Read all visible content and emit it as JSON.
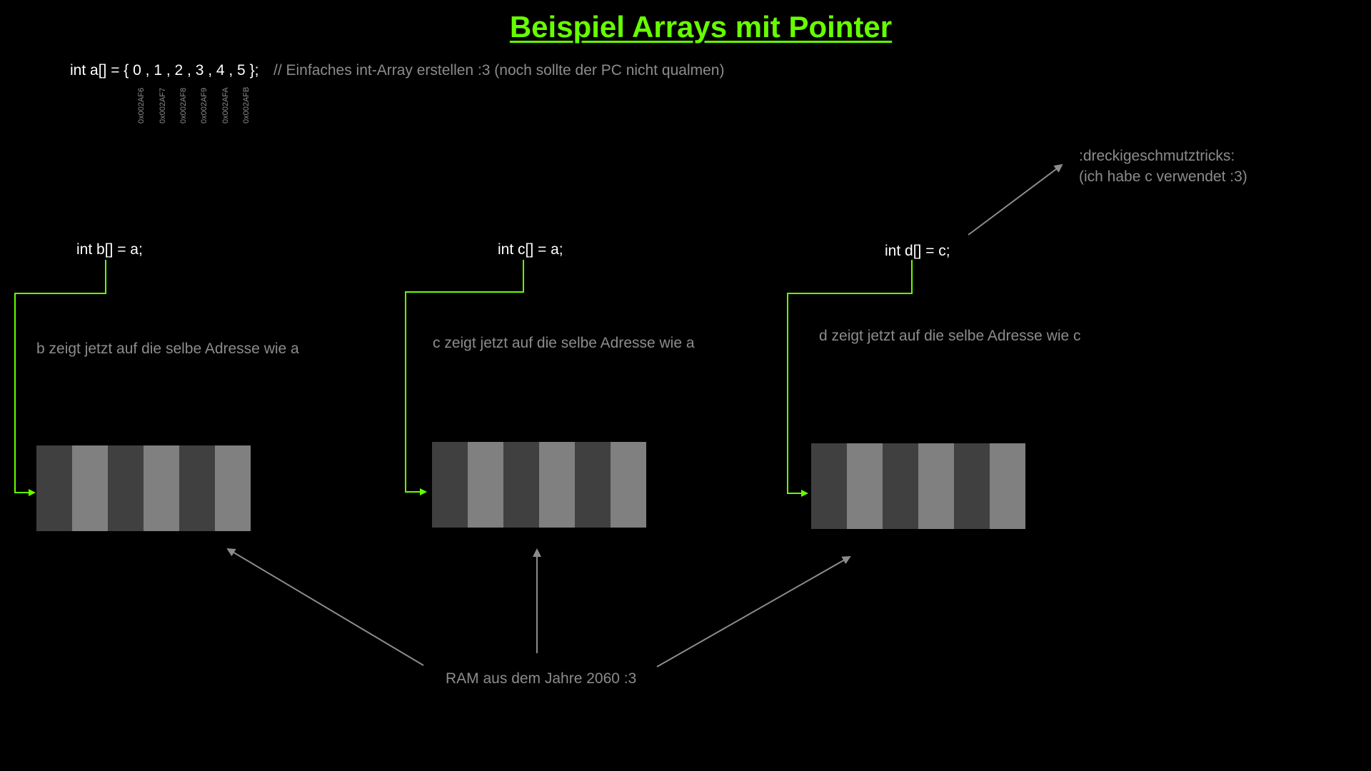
{
  "title": "Beispiel Arrays mit Pointer",
  "decl_a": {
    "code": "int a[] = { 0 , 1 , 2 , 3 , 4 , 5 };",
    "comment": "// Einfaches int-Array erstellen :3 (noch sollte der PC nicht qualmen)",
    "addresses": [
      "0x002AF6",
      "0x002AF7",
      "0x002AF8",
      "0x002AF9",
      "0x002AFA",
      "0x002AFB"
    ]
  },
  "blocks": [
    {
      "code": "int b[] = a;",
      "note": "b zeigt jetzt auf die selbe Adresse wie a"
    },
    {
      "code": "int c[] = a;",
      "note": "c zeigt jetzt auf die selbe Adresse wie a"
    },
    {
      "code": "int d[] = c;",
      "note": "d zeigt jetzt auf die selbe Adresse wie c"
    }
  ],
  "trick": {
    "line1": ":dreckigeschmutztricks:",
    "line2": "(ich habe c verwendet :3)"
  },
  "ram_label": "RAM aus dem Jahre 2060 :3",
  "colors": {
    "accent": "#66ff00",
    "text_gray": "#8c8c8c",
    "cell_dark": "#404040",
    "cell_light": "#808080"
  }
}
